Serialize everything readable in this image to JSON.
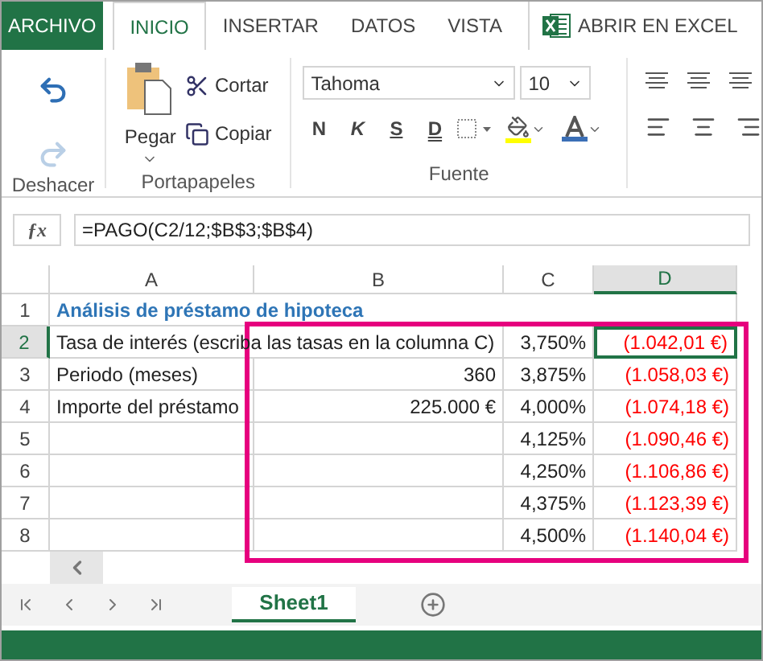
{
  "tabs": [
    {
      "label": "ARCHIVO",
      "kind": "file",
      "selected": false
    },
    {
      "label": "INICIO",
      "kind": "tab",
      "selected": true
    },
    {
      "label": "INSERTAR",
      "kind": "tab",
      "selected": false
    },
    {
      "label": "DATOS",
      "kind": "tab",
      "selected": false
    },
    {
      "label": "VISTA",
      "kind": "tab",
      "selected": false
    },
    {
      "label": "ABRIR EN EXCEL",
      "kind": "open",
      "selected": false
    }
  ],
  "ribbon": {
    "undo_group": {
      "label": "Deshacer",
      "redo_disabled": true
    },
    "clipboard_group": {
      "label": "Portapapeles",
      "paste": "Pegar",
      "cut": "Cortar",
      "copy": "Copiar"
    },
    "font_group": {
      "label": "Fuente",
      "font": "Tahoma",
      "size": "10",
      "styles": [
        "N",
        "K",
        "S",
        "D"
      ]
    }
  },
  "formula_bar": {
    "function_button": "ƒx",
    "formula": "=PAGO(C2/12;$B$3;$B$4)"
  },
  "columns": [
    {
      "label": "A",
      "selected": false
    },
    {
      "label": "B",
      "selected": false
    },
    {
      "label": "C",
      "selected": false
    },
    {
      "label": "D",
      "selected": true
    }
  ],
  "rows": [
    {
      "number": "1",
      "selected": false,
      "A": {
        "text": "Análisis de préstamo de hipoteca",
        "kind": "title"
      }
    },
    {
      "number": "2",
      "selected": true,
      "A": {
        "text": "Tasa de interés (escriba las tasas en la columna C)",
        "kind": "text"
      },
      "C": {
        "text": "3,750%",
        "kind": "number"
      },
      "D": {
        "text": "(1.042,01 €)",
        "kind": "negative",
        "active": true
      }
    },
    {
      "number": "3",
      "selected": false,
      "A": {
        "text": "Periodo (meses)",
        "kind": "text"
      },
      "B": {
        "text": "360",
        "kind": "number"
      },
      "C": {
        "text": "3,875%",
        "kind": "number"
      },
      "D": {
        "text": "(1.058,03 €)",
        "kind": "negative",
        "active": false
      }
    },
    {
      "number": "4",
      "selected": false,
      "A": {
        "text": "Importe del préstamo",
        "kind": "text"
      },
      "B": {
        "text": "225.000 €",
        "kind": "number"
      },
      "C": {
        "text": "4,000%",
        "kind": "number"
      },
      "D": {
        "text": "(1.074,18 €)",
        "kind": "negative",
        "active": false
      }
    },
    {
      "number": "5",
      "selected": false,
      "C": {
        "text": "4,125%",
        "kind": "number"
      },
      "D": {
        "text": "(1.090,46 €)",
        "kind": "negative",
        "active": false
      }
    },
    {
      "number": "6",
      "selected": false,
      "C": {
        "text": "4,250%",
        "kind": "number"
      },
      "D": {
        "text": "(1.106,86 €)",
        "kind": "negative",
        "active": false
      }
    },
    {
      "number": "7",
      "selected": false,
      "C": {
        "text": "4,375%",
        "kind": "number"
      },
      "D": {
        "text": "(1.123,39 €)",
        "kind": "negative",
        "active": false
      }
    },
    {
      "number": "8",
      "selected": false,
      "C": {
        "text": "4,500%",
        "kind": "number"
      },
      "D": {
        "text": "(1.140,04 €)",
        "kind": "negative",
        "active": false
      }
    }
  ],
  "sheet_tabs": [
    {
      "label": "Sheet1",
      "selected": true
    }
  ]
}
